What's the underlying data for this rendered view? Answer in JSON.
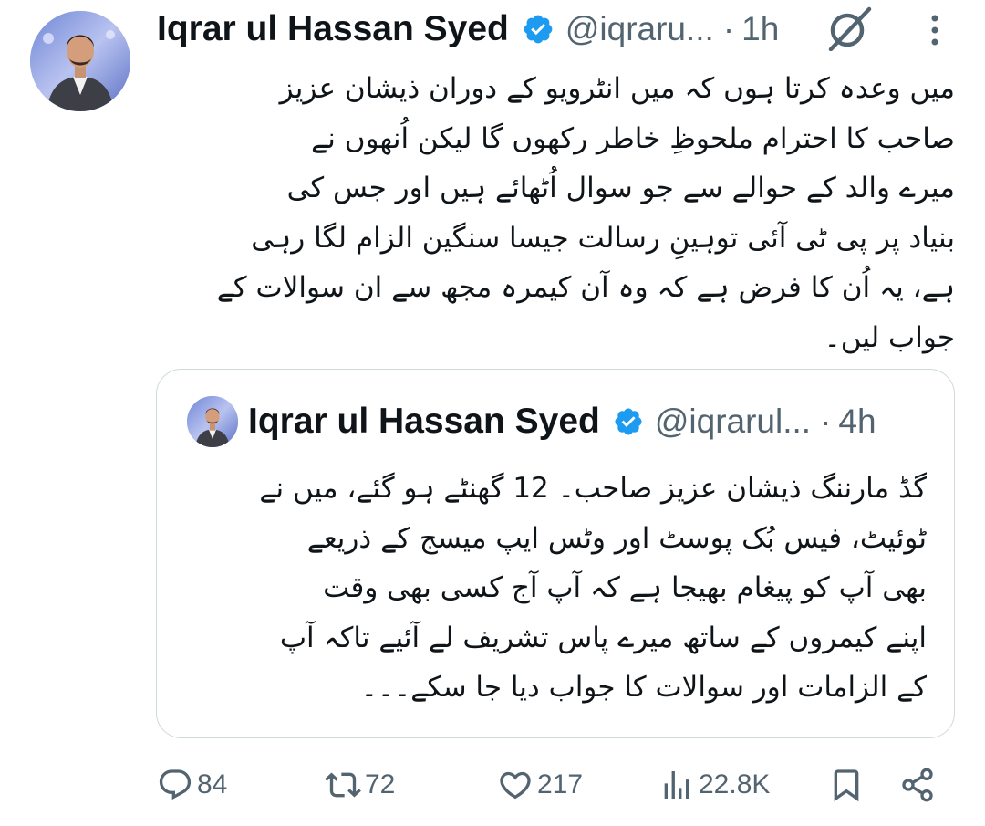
{
  "tweet": {
    "author_name": "Iqrar ul Hassan Syed",
    "handle": "@iqraru...",
    "separator": "·",
    "time": "1h",
    "lines": [
      "میں وعدہ کرتا ہوں کہ میں انٹرویو کے دوران ذیشان عزیز",
      "صاحب کا احترام ملحوظِ خاطر رکھوں گا لیکن اُنھوں نے",
      "میرے والد کے حوالے سے جو سوال اُٹھائے ہیں اور جس کی",
      "بنیاد پر پی ٹی آئی توہینِ رسالت جیسا سنگین الزام لگا رہی",
      "ہے، یہ اُن کا فرض ہے کہ وہ آن کیمرہ مجھ سے ان سوالات کے",
      "جواب لیں۔"
    ]
  },
  "quote": {
    "author_name": "Iqrar ul Hassan Syed",
    "handle": "@iqrarul...",
    "separator": "·",
    "time": "4h",
    "lines": [
      "گڈ مارننگ ذیشان عزیز صاحب۔ 12 گھنٹے ہو گئے، میں نے",
      "ٹوئیٹ، فیس بُک پوسٹ اور وٹس ایپ میسج کے ذریعے",
      "بھی آپ کو پیغام بھیجا ہے کہ آپ آج کسی بھی وقت",
      "اپنے کیمروں کے ساتھ میرے پاس تشریف لے آئیے تاکہ آپ",
      "کے الزامات اور سوالات کا جواب دیا جا سکے۔۔۔"
    ]
  },
  "actions": {
    "replies": "84",
    "reposts": "72",
    "likes": "217",
    "views": "22.8K"
  },
  "icons": {
    "verified": "verified-badge-icon",
    "grok": "grok-icon",
    "more": "more-vertical-icon",
    "reply": "reply-icon",
    "repost": "repost-icon",
    "like": "heart-icon",
    "views": "views-icon",
    "bookmark": "bookmark-icon",
    "share": "share-icon"
  },
  "colors": {
    "text": "#0f1419",
    "secondary": "#536471",
    "verified": "#1d9bf0",
    "border": "#cfd9de"
  }
}
